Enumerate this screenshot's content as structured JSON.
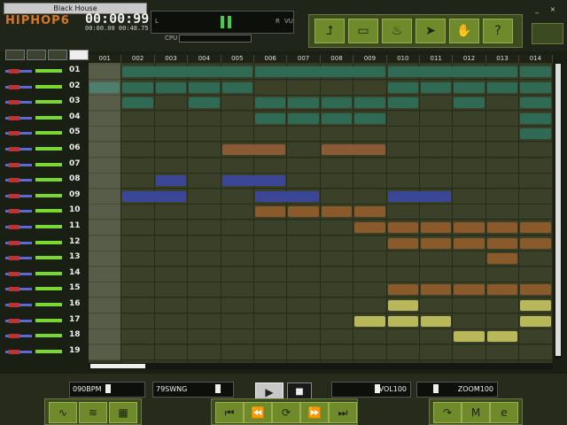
{
  "header": {
    "song_title": "Black House",
    "logo": "HIPHOP6",
    "time_main": "00:00:99",
    "time_sub": "00:00.00  00:48.75",
    "meter_left": "L",
    "meter_right": "R",
    "meter_vu": "VU",
    "cpu_label": "CPU"
  },
  "toolbar": {
    "buttons": [
      "arrow-up-icon",
      "folder-icon",
      "flame-icon",
      "runner-icon",
      "hand-icon",
      "question-icon"
    ]
  },
  "window": {
    "minimize": "_",
    "close": "×"
  },
  "tracks": [
    "01",
    "02",
    "03",
    "04",
    "05",
    "06",
    "07",
    "08",
    "09",
    "10",
    "11",
    "12",
    "13",
    "14",
    "15",
    "16",
    "17",
    "18",
    "19"
  ],
  "columns": [
    "001",
    "002",
    "003",
    "004",
    "005",
    "006",
    "007",
    "008",
    "009",
    "010",
    "011",
    "012",
    "013",
    "014"
  ],
  "clips": {
    "teal": "#2f6a55",
    "brown": "#8a5a34",
    "blue": "#3c4696",
    "orange": "#8a5a2a",
    "yellow": "#b8b85a"
  },
  "bottom": {
    "bpm": "090BPM",
    "swing": "79SWNG",
    "vol": "VOL100",
    "zoom": "ZOOM100"
  }
}
